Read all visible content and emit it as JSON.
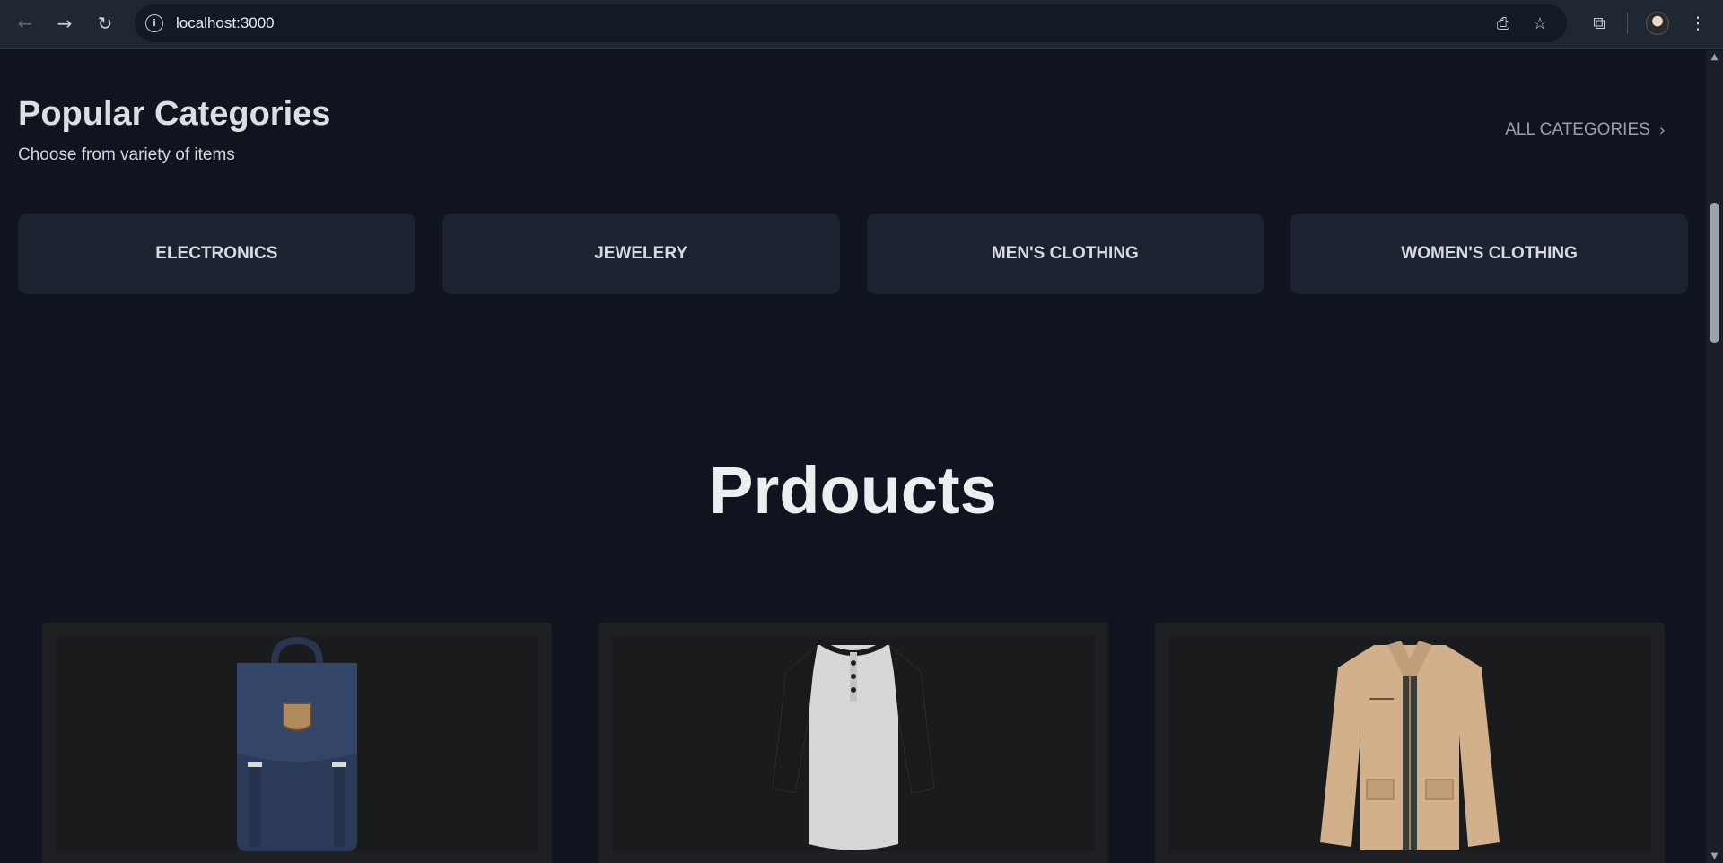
{
  "browser": {
    "url": "localhost:3000",
    "icons": {
      "back": "arrow-left-icon",
      "forward": "arrow-right-icon",
      "reload": "reload-icon",
      "site_info": "info-icon",
      "install": "install-icon",
      "bookmark": "star-icon",
      "extensions": "puzzle-icon",
      "menu": "kebab-icon"
    }
  },
  "categories": {
    "title": "Popular Categories",
    "subtitle": "Choose from variety of items",
    "all_link": "ALL CATEGORIES",
    "items": [
      {
        "label": "ELECTRONICS"
      },
      {
        "label": "JEWELERY"
      },
      {
        "label": "MEN'S CLOTHING"
      },
      {
        "label": "WOMEN'S CLOTHING"
      }
    ]
  },
  "products": {
    "title": "Prdoucts",
    "items": [
      {
        "image": "backpack-image"
      },
      {
        "image": "henley-shirt-image"
      },
      {
        "image": "jacket-image"
      }
    ]
  },
  "colors": {
    "page_bg": "#0f141f",
    "card_bg": "#1b2230",
    "product_card_bg": "#1e2023"
  }
}
